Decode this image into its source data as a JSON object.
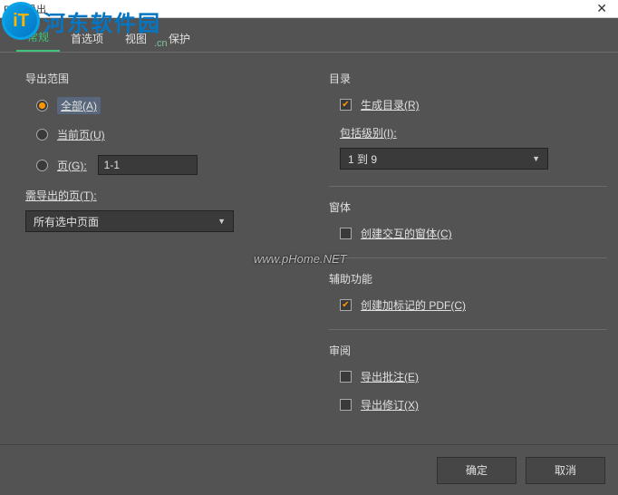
{
  "titlebar": {
    "title": "PDF 导出",
    "close": "✕"
  },
  "watermark": {
    "logo_text": "河东软件园",
    "logo_glyph": "iT",
    "suffix": ".cn",
    "center": "www.pHome.NET"
  },
  "tabs": {
    "general": "常规",
    "options": "首选项",
    "view": "视图",
    "protect": "保护"
  },
  "left": {
    "section_range": "导出范围",
    "opt_all": "全部(A)",
    "opt_current": "当前页(U)",
    "opt_pages": "页(G):",
    "pages_value": "1-1",
    "pages_to_export_label": "需导出的页(T):",
    "pages_select": "所有选中页面"
  },
  "right": {
    "section_toc": "目录",
    "chk_gen_toc": "生成目录(R)",
    "include_levels_label": "包括级别(I):",
    "levels_select": "1 到 9",
    "section_forms": "窗体",
    "chk_interactive_forms": "创建交互的窗体(C)",
    "section_a11y": "辅助功能",
    "chk_tagged_pdf": "创建加标记的 PDF(C)",
    "section_review": "审阅",
    "chk_export_comments": "导出批注(E)",
    "chk_export_revisions": "导出修订(X)"
  },
  "footer": {
    "ok": "确定",
    "cancel": "取消"
  }
}
